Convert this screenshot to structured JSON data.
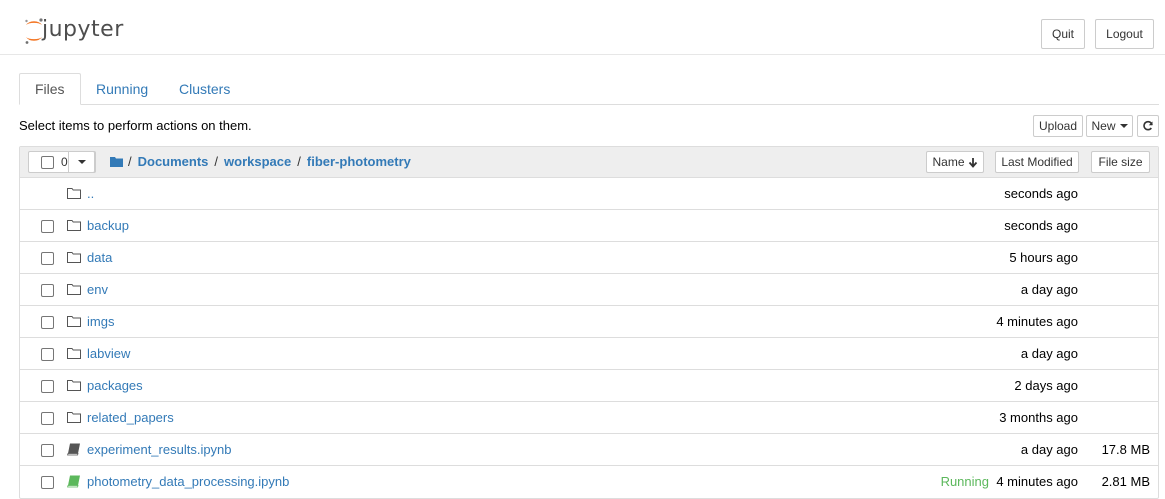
{
  "header": {
    "logo_text": "jupyter",
    "quit_label": "Quit",
    "logout_label": "Logout"
  },
  "tabs": [
    {
      "label": "Files",
      "active": true
    },
    {
      "label": "Running",
      "active": false
    },
    {
      "label": "Clusters",
      "active": false
    }
  ],
  "toolbar": {
    "hint": "Select items to perform actions on them.",
    "upload_label": "Upload",
    "new_label": "New",
    "refresh_icon": "refresh-icon"
  },
  "list_header": {
    "selected_count": "0",
    "breadcrumbs": [
      "Documents",
      "workspace",
      "fiber-photometry"
    ],
    "separator": "/",
    "sort_name": "Name",
    "sort_modified": "Last Modified",
    "sort_size": "File size"
  },
  "rows": [
    {
      "name": "..",
      "type": "folder",
      "modified": "seconds ago",
      "size": "",
      "status": "",
      "checkbox": false
    },
    {
      "name": "backup",
      "type": "folder",
      "modified": "seconds ago",
      "size": "",
      "status": "",
      "checkbox": true
    },
    {
      "name": "data",
      "type": "folder",
      "modified": "5 hours ago",
      "size": "",
      "status": "",
      "checkbox": true
    },
    {
      "name": "env",
      "type": "folder",
      "modified": "a day ago",
      "size": "",
      "status": "",
      "checkbox": true
    },
    {
      "name": "imgs",
      "type": "folder",
      "modified": "4 minutes ago",
      "size": "",
      "status": "",
      "checkbox": true
    },
    {
      "name": "labview",
      "type": "folder",
      "modified": "a day ago",
      "size": "",
      "status": "",
      "checkbox": true
    },
    {
      "name": "packages",
      "type": "folder",
      "modified": "2 days ago",
      "size": "",
      "status": "",
      "checkbox": true
    },
    {
      "name": "related_papers",
      "type": "folder",
      "modified": "3 months ago",
      "size": "",
      "status": "",
      "checkbox": true
    },
    {
      "name": "experiment_results.ipynb",
      "type": "notebook",
      "modified": "a day ago",
      "size": "17.8 MB",
      "status": "",
      "checkbox": true
    },
    {
      "name": "photometry_data_processing.ipynb",
      "type": "notebook-running",
      "modified": "4 minutes ago",
      "size": "2.81 MB",
      "status": "Running",
      "checkbox": true
    }
  ],
  "colors": {
    "link": "#337ab7",
    "running": "#5cb85c",
    "logo_orange": "#f37726"
  }
}
